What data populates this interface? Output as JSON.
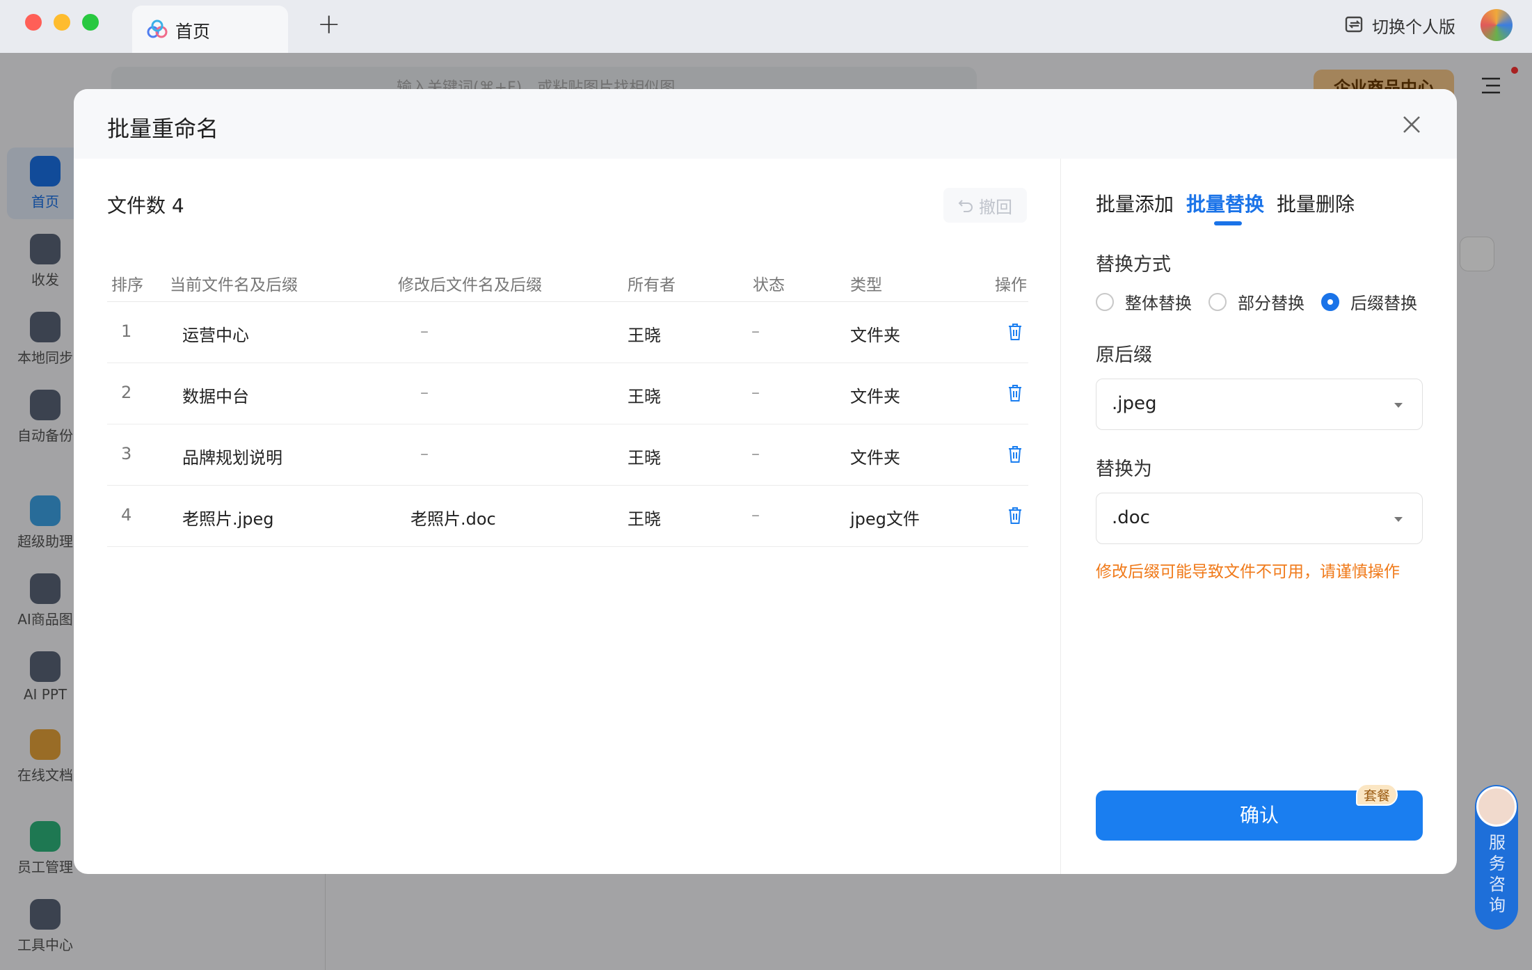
{
  "window": {
    "tab_label": "首页",
    "new_tab": "+",
    "switch_label": "切换个人版"
  },
  "app": {
    "search_placeholder": "输入关键词(⌘+F)，或粘贴图片找相似图",
    "enterprise_button": "企业商品中心",
    "sidebar": [
      {
        "label": "首页",
        "icon": "home-icon",
        "color": "#1a73e8"
      },
      {
        "label": "收发",
        "icon": "transfer-icon",
        "color": "#5a6478"
      },
      {
        "label": "本地同步",
        "icon": "sync-icon",
        "color": "#5a6478"
      },
      {
        "label": "自动备份",
        "icon": "backup-icon",
        "color": "#5a6478"
      },
      {
        "label": "超级助理",
        "icon": "assistant-icon",
        "color": "#3da5e8"
      },
      {
        "label": "AI商品图",
        "icon": "ai-product-icon",
        "color": "#5a6478"
      },
      {
        "label": "AI PPT",
        "icon": "ppt-icon",
        "color": "#5a6478"
      },
      {
        "label": "在线文档",
        "icon": "document-icon",
        "color": "#e8a53a"
      },
      {
        "label": "员工管理",
        "icon": "staff-icon",
        "color": "#2eb67d"
      },
      {
        "label": "工具中心",
        "icon": "tools-icon",
        "color": "#5a6478"
      }
    ]
  },
  "dialog": {
    "title": "批量重命名",
    "file_count_label": "文件数 4",
    "undo_label": "撤回",
    "columns": [
      "排序",
      "当前文件名及后缀",
      "修改后文件名及后缀",
      "所有者",
      "状态",
      "类型",
      "操作"
    ],
    "rows": [
      {
        "index": "1",
        "current": "运营中心",
        "modified": "–",
        "owner": "王晓",
        "status": "–",
        "type": "文件夹"
      },
      {
        "index": "2",
        "current": "数据中台",
        "modified": "–",
        "owner": "王晓",
        "status": "–",
        "type": "文件夹"
      },
      {
        "index": "3",
        "current": "品牌规划说明",
        "modified": "–",
        "owner": "王晓",
        "status": "–",
        "type": "文件夹"
      },
      {
        "index": "4",
        "current": "老照片.jpeg",
        "modified": "老照片.doc",
        "owner": "王晓",
        "status": "–",
        "type": "jpeg文件"
      }
    ],
    "tabs": [
      "批量添加",
      "批量替换",
      "批量删除"
    ],
    "active_tab": "批量替换",
    "replace_mode_label": "替换方式",
    "modes": [
      "整体替换",
      "部分替换",
      "后缀替换"
    ],
    "selected_mode": "后缀替换",
    "original_suffix_label": "原后缀",
    "original_suffix_value": ".jpeg",
    "replace_with_label": "替换为",
    "replace_with_value": ".doc",
    "warning": "修改后缀可能导致文件不可用，请谨慎操作",
    "confirm_label": "确认",
    "plan_badge": "套餐"
  },
  "service": {
    "label": "服务咨询"
  },
  "colors": {
    "primary": "#1a7ef0",
    "warning": "#f07a1a",
    "accent_blue": "#1a73e8"
  }
}
